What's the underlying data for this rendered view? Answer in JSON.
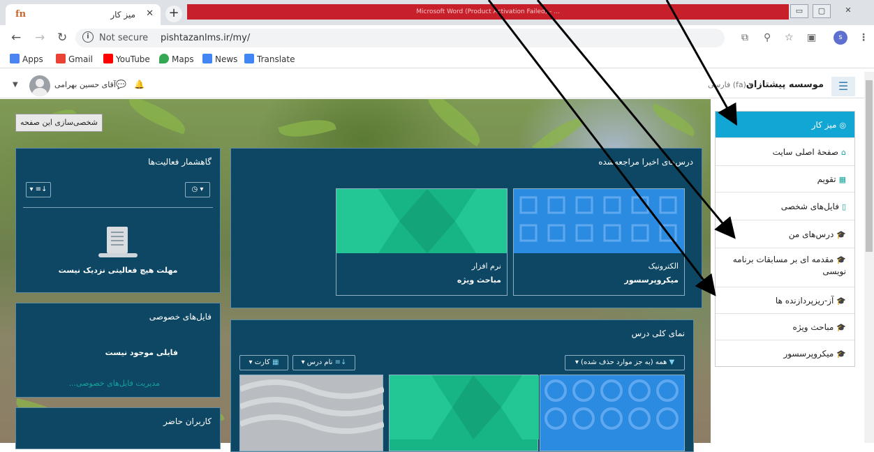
{
  "browser": {
    "tab_title": "میز کار",
    "tab_favicon": "fn",
    "red_bar_text": "Microsoft Word (Product Activation Failed) - ...",
    "url_security": "Not secure",
    "url": "pishtazanlms.ir/my/",
    "profile_initial": "s"
  },
  "bookmarks": [
    {
      "label": "Apps",
      "icon": "apps-grid-icon",
      "color": "#4a84f0"
    },
    {
      "label": "Gmail",
      "icon": "gmail-icon",
      "color": "#ea4335"
    },
    {
      "label": "YouTube",
      "icon": "youtube-icon",
      "color": "#ff0000"
    },
    {
      "label": "Maps",
      "icon": "maps-pin-icon",
      "color": "#34a853"
    },
    {
      "label": "News",
      "icon": "news-icon",
      "color": "#4285f4"
    },
    {
      "label": "Translate",
      "icon": "translate-icon",
      "color": "#4285f4"
    }
  ],
  "navbar": {
    "brand": "موسسه پیشتازان",
    "language": "فارسی (fa)",
    "user_name": "آقای حسین بهرامی"
  },
  "page": {
    "customize_button": "شخصی‌سازی این صفحه"
  },
  "recent_courses": {
    "title": "درس‌های اخیرا مراجعه‌شده",
    "courses": [
      {
        "category": "الکترونیک",
        "name": "میکروپرسسور"
      },
      {
        "category": "نرم افزار",
        "name": "مباحث ویژه"
      }
    ]
  },
  "timeline": {
    "title": "گاهشمار فعالیت‌ها",
    "empty_message": "مهلت هیچ فعالیتی نزدیک نیست"
  },
  "private_files": {
    "title": "فایل‌های خصوصی",
    "empty_message": "فایلی موجود نیست",
    "manage_link": "مدیریت فایل‌های خصوصی..."
  },
  "online_users": {
    "title": "کاربران حاضر"
  },
  "course_overview": {
    "title": "نمای کلی درس",
    "filter_button": "همه (به جز موارد حذف شده)",
    "sort_button": "نام درس",
    "view_button": "کارت"
  },
  "sidebar": {
    "items": [
      {
        "label": "میز کار",
        "icon": "dashboard-icon",
        "active": true
      },
      {
        "label": "صفحهٔ اصلی سایت",
        "icon": "home-icon",
        "active": false
      },
      {
        "label": "تقویم",
        "icon": "calendar-icon",
        "active": false
      },
      {
        "label": "فایل‌های شخصی",
        "icon": "file-icon",
        "active": false
      },
      {
        "label": "درس‌های من",
        "icon": "graduation-cap-icon",
        "active": false
      },
      {
        "label": "مقدمه ای بر مسابقات برنامه نویسی",
        "icon": "graduation-cap-icon",
        "active": false
      },
      {
        "label": "آز-ریزپردازنده ها",
        "icon": "graduation-cap-icon",
        "active": false
      },
      {
        "label": "مباحث ویژه",
        "icon": "graduation-cap-icon",
        "active": false
      },
      {
        "label": "میکروپرسسور",
        "icon": "graduation-cap-icon",
        "active": false
      }
    ]
  },
  "colors": {
    "panel": "#0d4763",
    "accent": "#12a6d4",
    "teal": "#13a39a"
  }
}
